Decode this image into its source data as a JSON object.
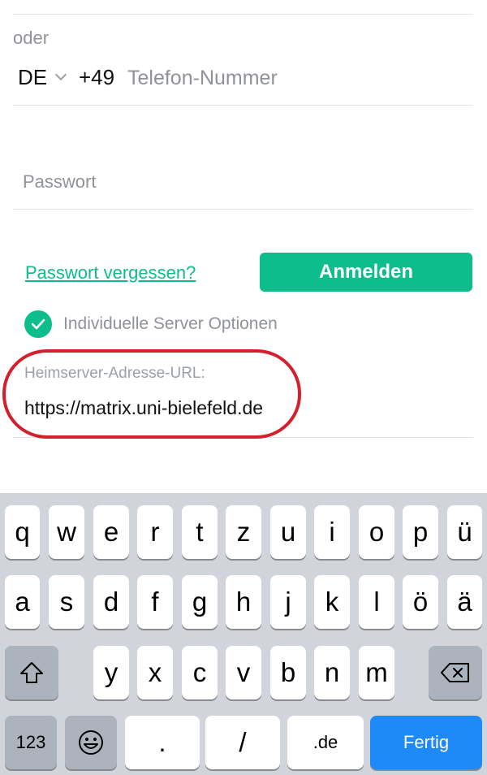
{
  "form": {
    "oder": "oder",
    "country_code": "DE",
    "dial_code": "+49",
    "phone_placeholder": "Telefon-Nummer",
    "password_placeholder": "Passwort",
    "forgot_link": "Passwort vergessen?",
    "login_button": "Anmelden",
    "server_options_label": "Individuelle Server Optionen",
    "server_options_checked": true,
    "homeserver_label": "Heimserver-Adresse-URL:",
    "homeserver_value": "https://matrix.uni-bielefeld.de"
  },
  "colors": {
    "accent": "#0dbd8b",
    "highlight": "#d4202c",
    "keyboard_bg": "#d1d4da",
    "return_key": "#1e8af8"
  },
  "keyboard": {
    "row1": [
      "q",
      "w",
      "e",
      "r",
      "t",
      "z",
      "u",
      "i",
      "o",
      "p",
      "ü"
    ],
    "row2": [
      "a",
      "s",
      "d",
      "f",
      "g",
      "h",
      "j",
      "k",
      "l",
      "ö",
      "ä"
    ],
    "row3": [
      "y",
      "x",
      "c",
      "v",
      "b",
      "n",
      "m"
    ],
    "shift_icon": "shift-icon",
    "delete_icon": "backspace-icon",
    "numbers": "123",
    "emoji_icon": "emoji-icon",
    "dot": ".",
    "slash": "/",
    "domain": ".de",
    "return": "Fertig"
  }
}
